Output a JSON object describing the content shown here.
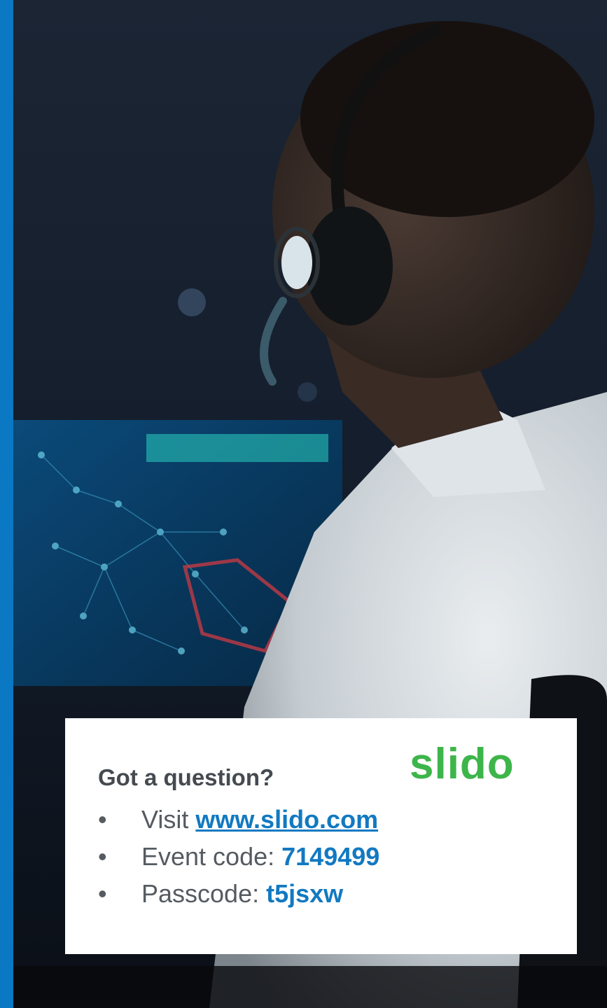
{
  "card": {
    "heading": "Got a question?",
    "logo_text": "slido",
    "items": [
      {
        "bullet": "•",
        "label": "Visit ",
        "value": "www.slido.com"
      },
      {
        "bullet": "•",
        "label": "Event code: ",
        "value": "7149499"
      },
      {
        "bullet": "•",
        "label": "Passcode: ",
        "value": "t5jsxw"
      }
    ]
  },
  "colors": {
    "accent_bar": "#0a78c2",
    "brand_green": "#3db54a",
    "link_blue": "#1279c1"
  }
}
